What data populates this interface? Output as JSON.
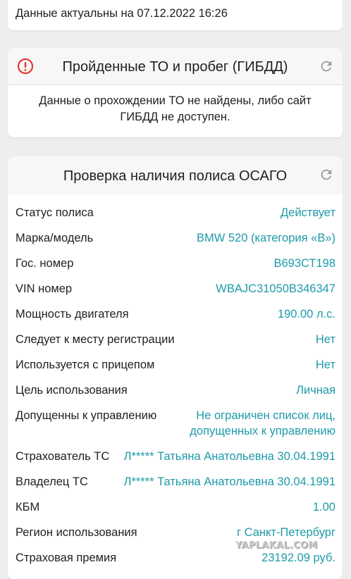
{
  "date_card": {
    "text": "Данные актуальны на 07.12.2022 16:26"
  },
  "gibdd_card": {
    "title": "Пройденные ТО и пробег (ГИБДД)",
    "message": "Данные о прохождении ТО не найдены, либо сайт ГИБДД не доступен.",
    "alert_icon": "alert-circle-icon",
    "refresh_icon": "refresh-icon",
    "alert_color": "#e53935"
  },
  "osago_card": {
    "title": "Проверка наличия полиса ОСАГО",
    "refresh_icon": "refresh-icon",
    "value_color": "#1e9aa8",
    "rows": [
      {
        "label": "Статус полиса",
        "value": "Действует"
      },
      {
        "label": "Марка/модель",
        "value": "BMW 520 (категория «B»)"
      },
      {
        "label": "Гос. номер",
        "value": "В693СТ198"
      },
      {
        "label": "VIN номер",
        "value": "WBAJC31050B346347"
      },
      {
        "label": "Мощность двигателя",
        "value": "190.00 л.с."
      },
      {
        "label": "Следует к месту регистрации",
        "value": "Нет"
      },
      {
        "label": "Используется с прицепом",
        "value": "Нет"
      },
      {
        "label": "Цель использования",
        "value": "Личная"
      },
      {
        "label": "Допущенны к управлению",
        "value_line1": "Не ограничен список лиц,",
        "value_line2": "допущенных к управлению"
      },
      {
        "label": "Страхователь ТС",
        "value": "Л***** Татьяна Анатольевна 30.04.1991"
      },
      {
        "label": "Владелец ТС",
        "value": "Л***** Татьяна Анатольевна 30.04.1991"
      },
      {
        "label": "КБМ",
        "value": "1.00"
      },
      {
        "label": "Регион использования",
        "value": "г Санкт-Петербург"
      },
      {
        "label": "Страховая премия",
        "value": "23192.09 руб."
      }
    ]
  },
  "watermark": {
    "text": "YAPLAKAL.COM"
  }
}
